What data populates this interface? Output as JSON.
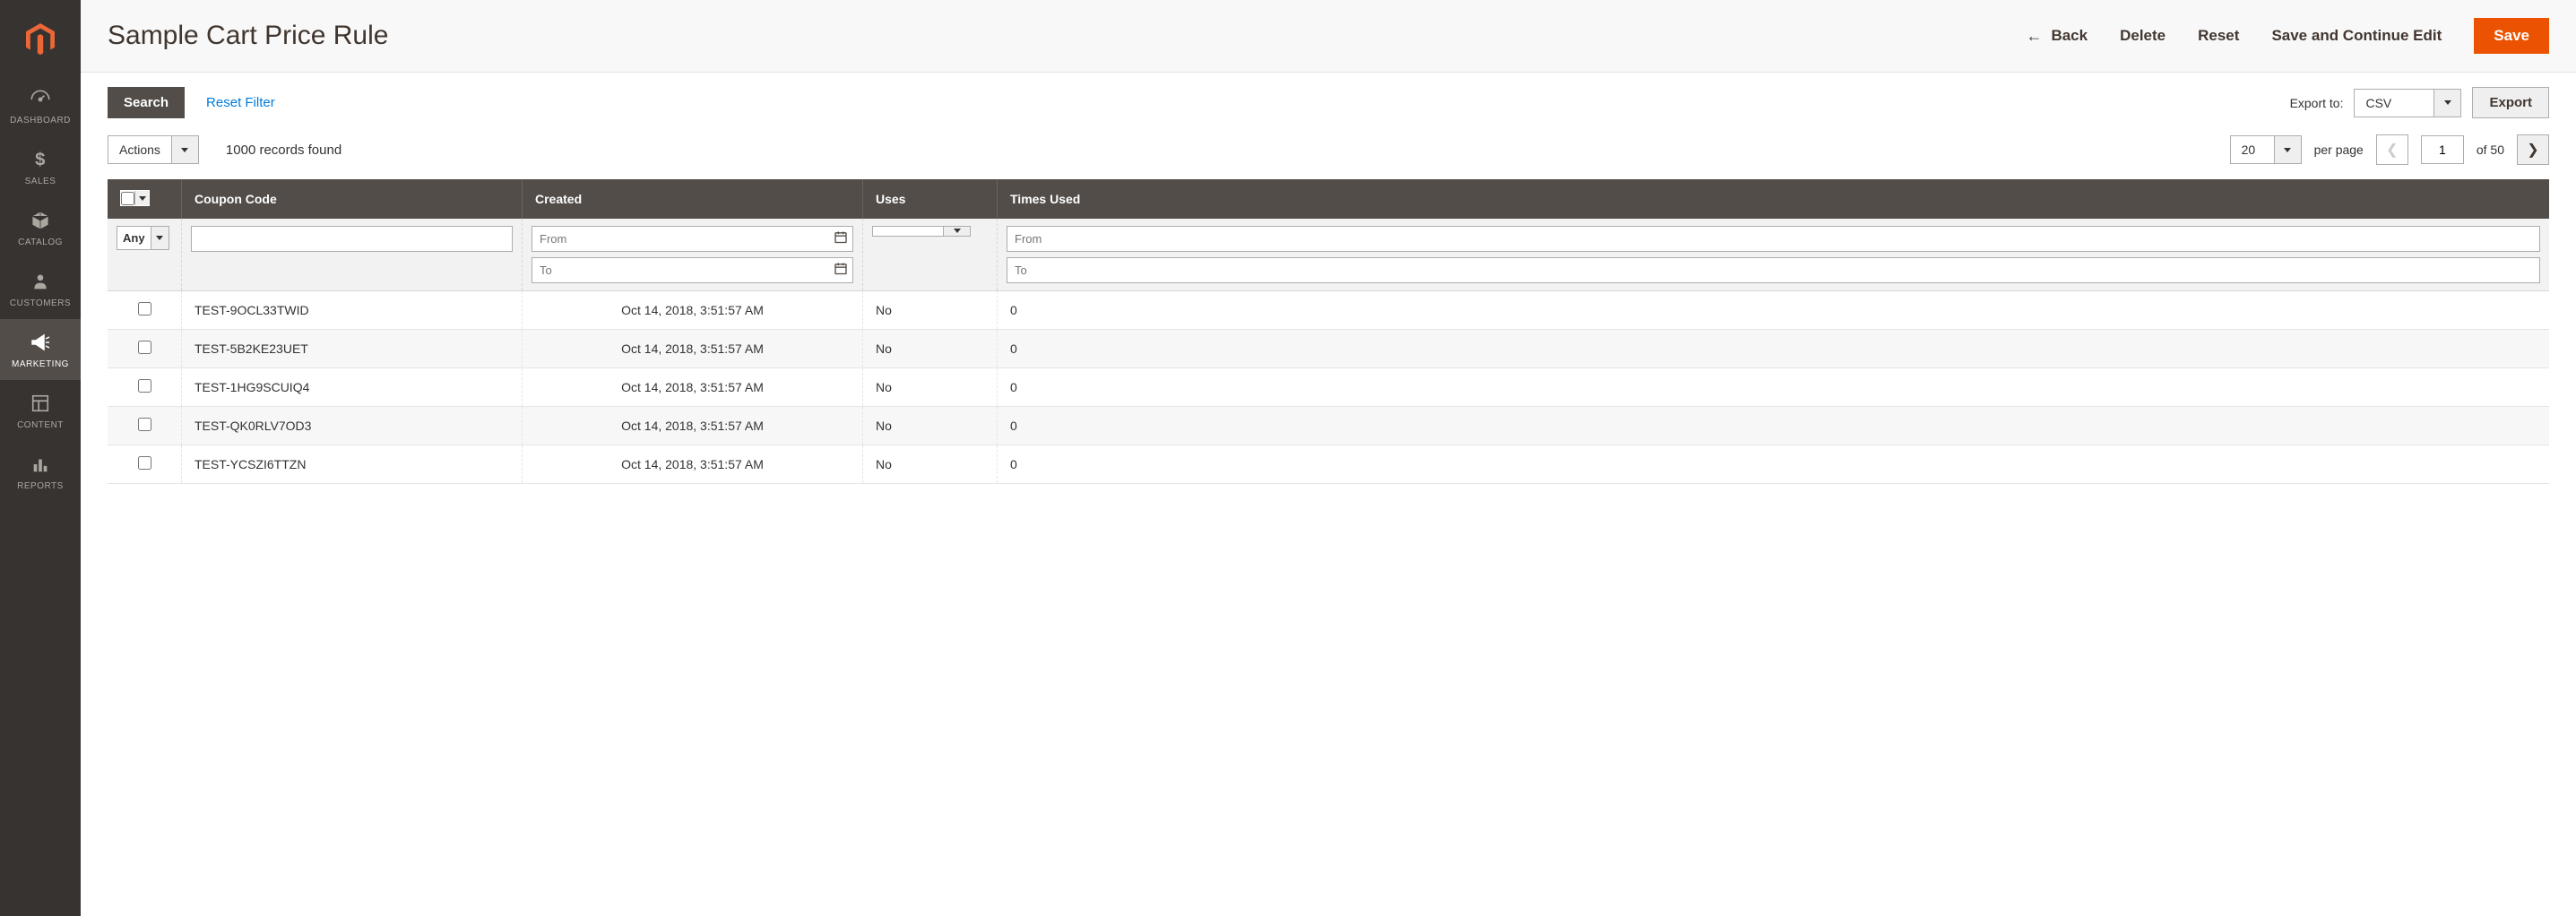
{
  "sidebar": {
    "items": [
      {
        "label": "DASHBOARD"
      },
      {
        "label": "SALES"
      },
      {
        "label": "CATALOG"
      },
      {
        "label": "CUSTOMERS"
      },
      {
        "label": "MARKETING"
      },
      {
        "label": "CONTENT"
      },
      {
        "label": "REPORTS"
      }
    ]
  },
  "header": {
    "title": "Sample Cart Price Rule",
    "back": "Back",
    "delete": "Delete",
    "reset": "Reset",
    "save_continue": "Save and Continue Edit",
    "save": "Save"
  },
  "toolbar": {
    "search": "Search",
    "reset_filter": "Reset Filter",
    "export_to": "Export to:",
    "export_format": "CSV",
    "export": "Export"
  },
  "subtoolbar": {
    "actions": "Actions",
    "records_found": "1000 records found",
    "per_page_value": "20",
    "per_page_label": "per page",
    "current_page": "1",
    "of_pages": "of 50"
  },
  "table": {
    "headers": {
      "coupon_code": "Coupon Code",
      "created": "Created",
      "uses": "Uses",
      "times_used": "Times Used"
    },
    "filters": {
      "any": "Any",
      "from": "From",
      "to": "To"
    },
    "rows": [
      {
        "code": "TEST-9OCL33TWID",
        "created": "Oct 14, 2018, 3:51:57 AM",
        "uses": "No",
        "times": "0"
      },
      {
        "code": "TEST-5B2KE23UET",
        "created": "Oct 14, 2018, 3:51:57 AM",
        "uses": "No",
        "times": "0"
      },
      {
        "code": "TEST-1HG9SCUIQ4",
        "created": "Oct 14, 2018, 3:51:57 AM",
        "uses": "No",
        "times": "0"
      },
      {
        "code": "TEST-QK0RLV7OD3",
        "created": "Oct 14, 2018, 3:51:57 AM",
        "uses": "No",
        "times": "0"
      },
      {
        "code": "TEST-YCSZI6TTZN",
        "created": "Oct 14, 2018, 3:51:57 AM",
        "uses": "No",
        "times": "0"
      }
    ]
  }
}
